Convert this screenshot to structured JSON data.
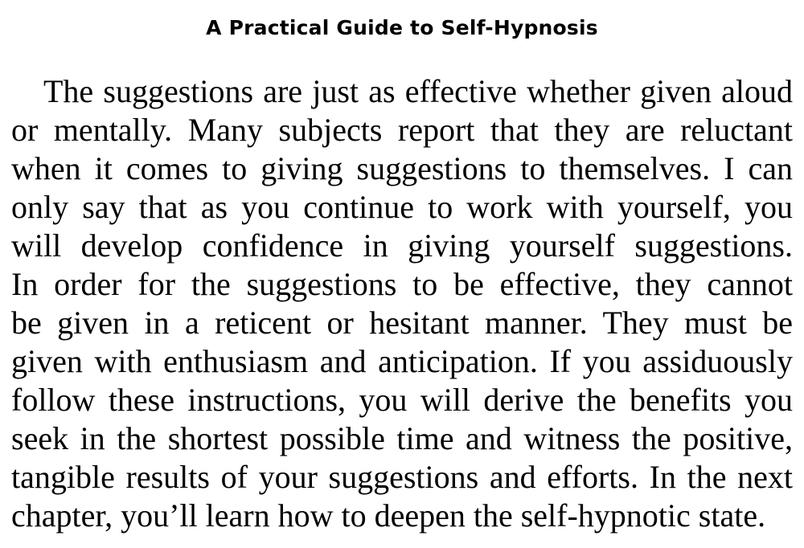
{
  "page": {
    "running_head": "A Practical Guide to Self-Hypnosis",
    "paragraph_lines": [
      "The suggestions are just as effective whether given aloud",
      "or mentally. Many subjects report that they are reluctant",
      "when it comes to giving suggestions to themselves. I can",
      "only say that as you continue to work with yourself, you",
      "will develop confidence in giving yourself suggestions.",
      "In order for the suggestions to be effective, they cannot",
      "be given in a reticent or hesitant manner. They must be",
      "given with enthusiasm and anticipation. If you assiduously",
      "follow these instructions, you will derive the benefits you",
      "seek in the shortest possible time and witness the positive,",
      "tangible results of your suggestions and efforts. In the next",
      "chapter, you’ll learn how to deepen the self-hypnotic state."
    ]
  }
}
